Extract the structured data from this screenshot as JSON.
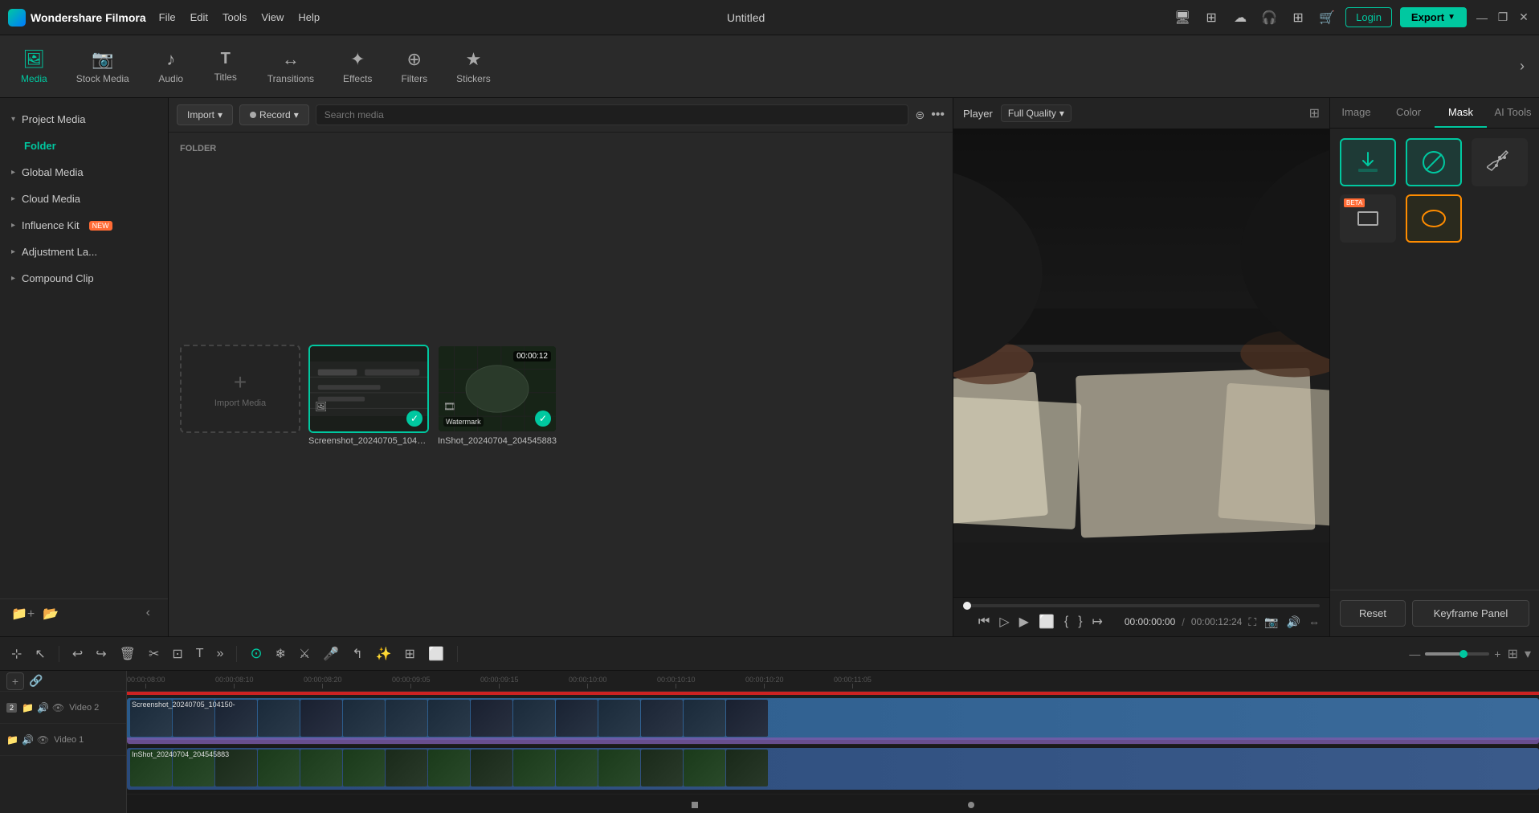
{
  "app": {
    "name": "Wondershare Filmora",
    "title": "Untitled"
  },
  "topbar": {
    "menu": [
      "File",
      "Edit",
      "Tools",
      "View",
      "Help"
    ],
    "login_label": "Login",
    "export_label": "Export",
    "win_minimize": "—",
    "win_restore": "❐",
    "win_close": "✕"
  },
  "toolbar": {
    "tabs": [
      {
        "id": "media",
        "label": "Media",
        "icon": "🎬",
        "active": true
      },
      {
        "id": "stock",
        "label": "Stock Media",
        "icon": "📷"
      },
      {
        "id": "audio",
        "label": "Audio",
        "icon": "♪"
      },
      {
        "id": "titles",
        "label": "Titles",
        "icon": "T"
      },
      {
        "id": "transitions",
        "label": "Transitions",
        "icon": "↔"
      },
      {
        "id": "effects",
        "label": "Effects",
        "icon": "✦"
      },
      {
        "id": "filters",
        "label": "Filters",
        "icon": "⊕"
      },
      {
        "id": "stickers",
        "label": "Stickers",
        "icon": "★"
      }
    ]
  },
  "sidebar": {
    "items": [
      {
        "label": "Project Media",
        "arrow": "▸",
        "active": false
      },
      {
        "label": "Folder",
        "active": true
      },
      {
        "label": "Global Media",
        "arrow": "▸"
      },
      {
        "label": "Cloud Media",
        "arrow": "▸"
      },
      {
        "label": "Influence Kit",
        "arrow": "▸",
        "badge": "NEW"
      },
      {
        "label": "Adjustment La...",
        "arrow": "▸"
      },
      {
        "label": "Compound Clip",
        "arrow": "▸"
      }
    ]
  },
  "media_panel": {
    "import_label": "Import",
    "record_label": "Record",
    "search_placeholder": "Search media",
    "folder_label": "FOLDER",
    "add_tile_label": "Import Media",
    "items": [
      {
        "name": "Screenshot_20240705_104150",
        "selected": true,
        "type": "image"
      },
      {
        "name": "InShot_20240704_204545883",
        "duration": "00:00:12",
        "type": "video",
        "watermark": "Watermark"
      }
    ]
  },
  "player": {
    "label": "Player",
    "quality": "Full Quality",
    "time_current": "00:00:00:00",
    "time_total": "00:00:12:24"
  },
  "right_panel": {
    "tabs": [
      "Image",
      "Color",
      "Mask",
      "AI Tools"
    ],
    "active_tab": "Mask",
    "mask_shapes": [
      {
        "id": "download",
        "icon": "↓",
        "active": true,
        "type": "download"
      },
      {
        "id": "circle-line",
        "icon": "circle-slash",
        "active": true,
        "selected": false
      },
      {
        "id": "pen",
        "icon": "pen",
        "active": false
      },
      {
        "id": "beta-rect",
        "icon": "rect",
        "beta": true,
        "active": false
      },
      {
        "id": "ellipse",
        "icon": "ellipse",
        "active": false,
        "selected": true,
        "orange": true
      }
    ],
    "reset_label": "Reset",
    "keyframe_label": "Keyframe Panel"
  },
  "timeline": {
    "tracks": [
      {
        "label": "Video 2",
        "clip_label": "Screenshot_20240705_104150-",
        "type": "video"
      },
      {
        "label": "Video 1",
        "clip_label": "InShot_20240704_204545883",
        "type": "video"
      }
    ],
    "timestamps": [
      "00:00:08:00",
      "00:00:08:10",
      "00:00:08:20",
      "00:00:09:05",
      "00:00:09:15",
      "00:00:10:00",
      "00:00:10:10",
      "00:00:10:20",
      "00:00:11:05",
      "00:00:1"
    ]
  }
}
